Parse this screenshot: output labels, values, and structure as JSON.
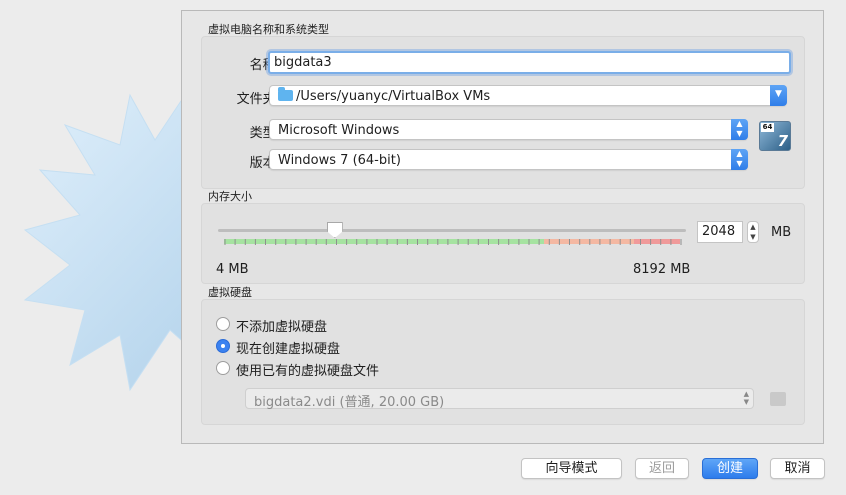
{
  "sections": {
    "name_os": "虚拟电脑名称和系统类型",
    "memory": "内存大小",
    "disk": "虚拟硬盘"
  },
  "form": {
    "name_label": "名称:",
    "name_value": "bigdata3",
    "folder_label": "文件夹:",
    "folder_value": "/Users/yuanyc/VirtualBox VMs",
    "type_label": "类型:",
    "type_value": "Microsoft Windows",
    "version_label": "版本:",
    "version_value": "Windows 7 (64-bit)",
    "os_icon": {
      "bits": "64",
      "digit": "7"
    }
  },
  "memory": {
    "value": "2048",
    "unit": "MB",
    "min_label": "4 MB",
    "max_label": "8192 MB",
    "slider_value_mb": 2048,
    "slider_min_mb": 4,
    "slider_max_mb": 8192
  },
  "disk": {
    "options": [
      {
        "label": "不添加虚拟硬盘",
        "checked": false
      },
      {
        "label": "现在创建虚拟硬盘",
        "checked": true
      },
      {
        "label": "使用已有的虚拟硬盘文件",
        "checked": false
      }
    ],
    "existing_file": "bigdata2.vdi (普通, 20.00 GB)"
  },
  "buttons": {
    "guided": "向导模式",
    "back": "返回",
    "create": "创建",
    "cancel": "取消"
  },
  "colors": {
    "accent": "#2d7cec",
    "scale_green": "#9fe09a",
    "scale_orange": "#f4b29a",
    "scale_red": "#ee8d8d"
  }
}
